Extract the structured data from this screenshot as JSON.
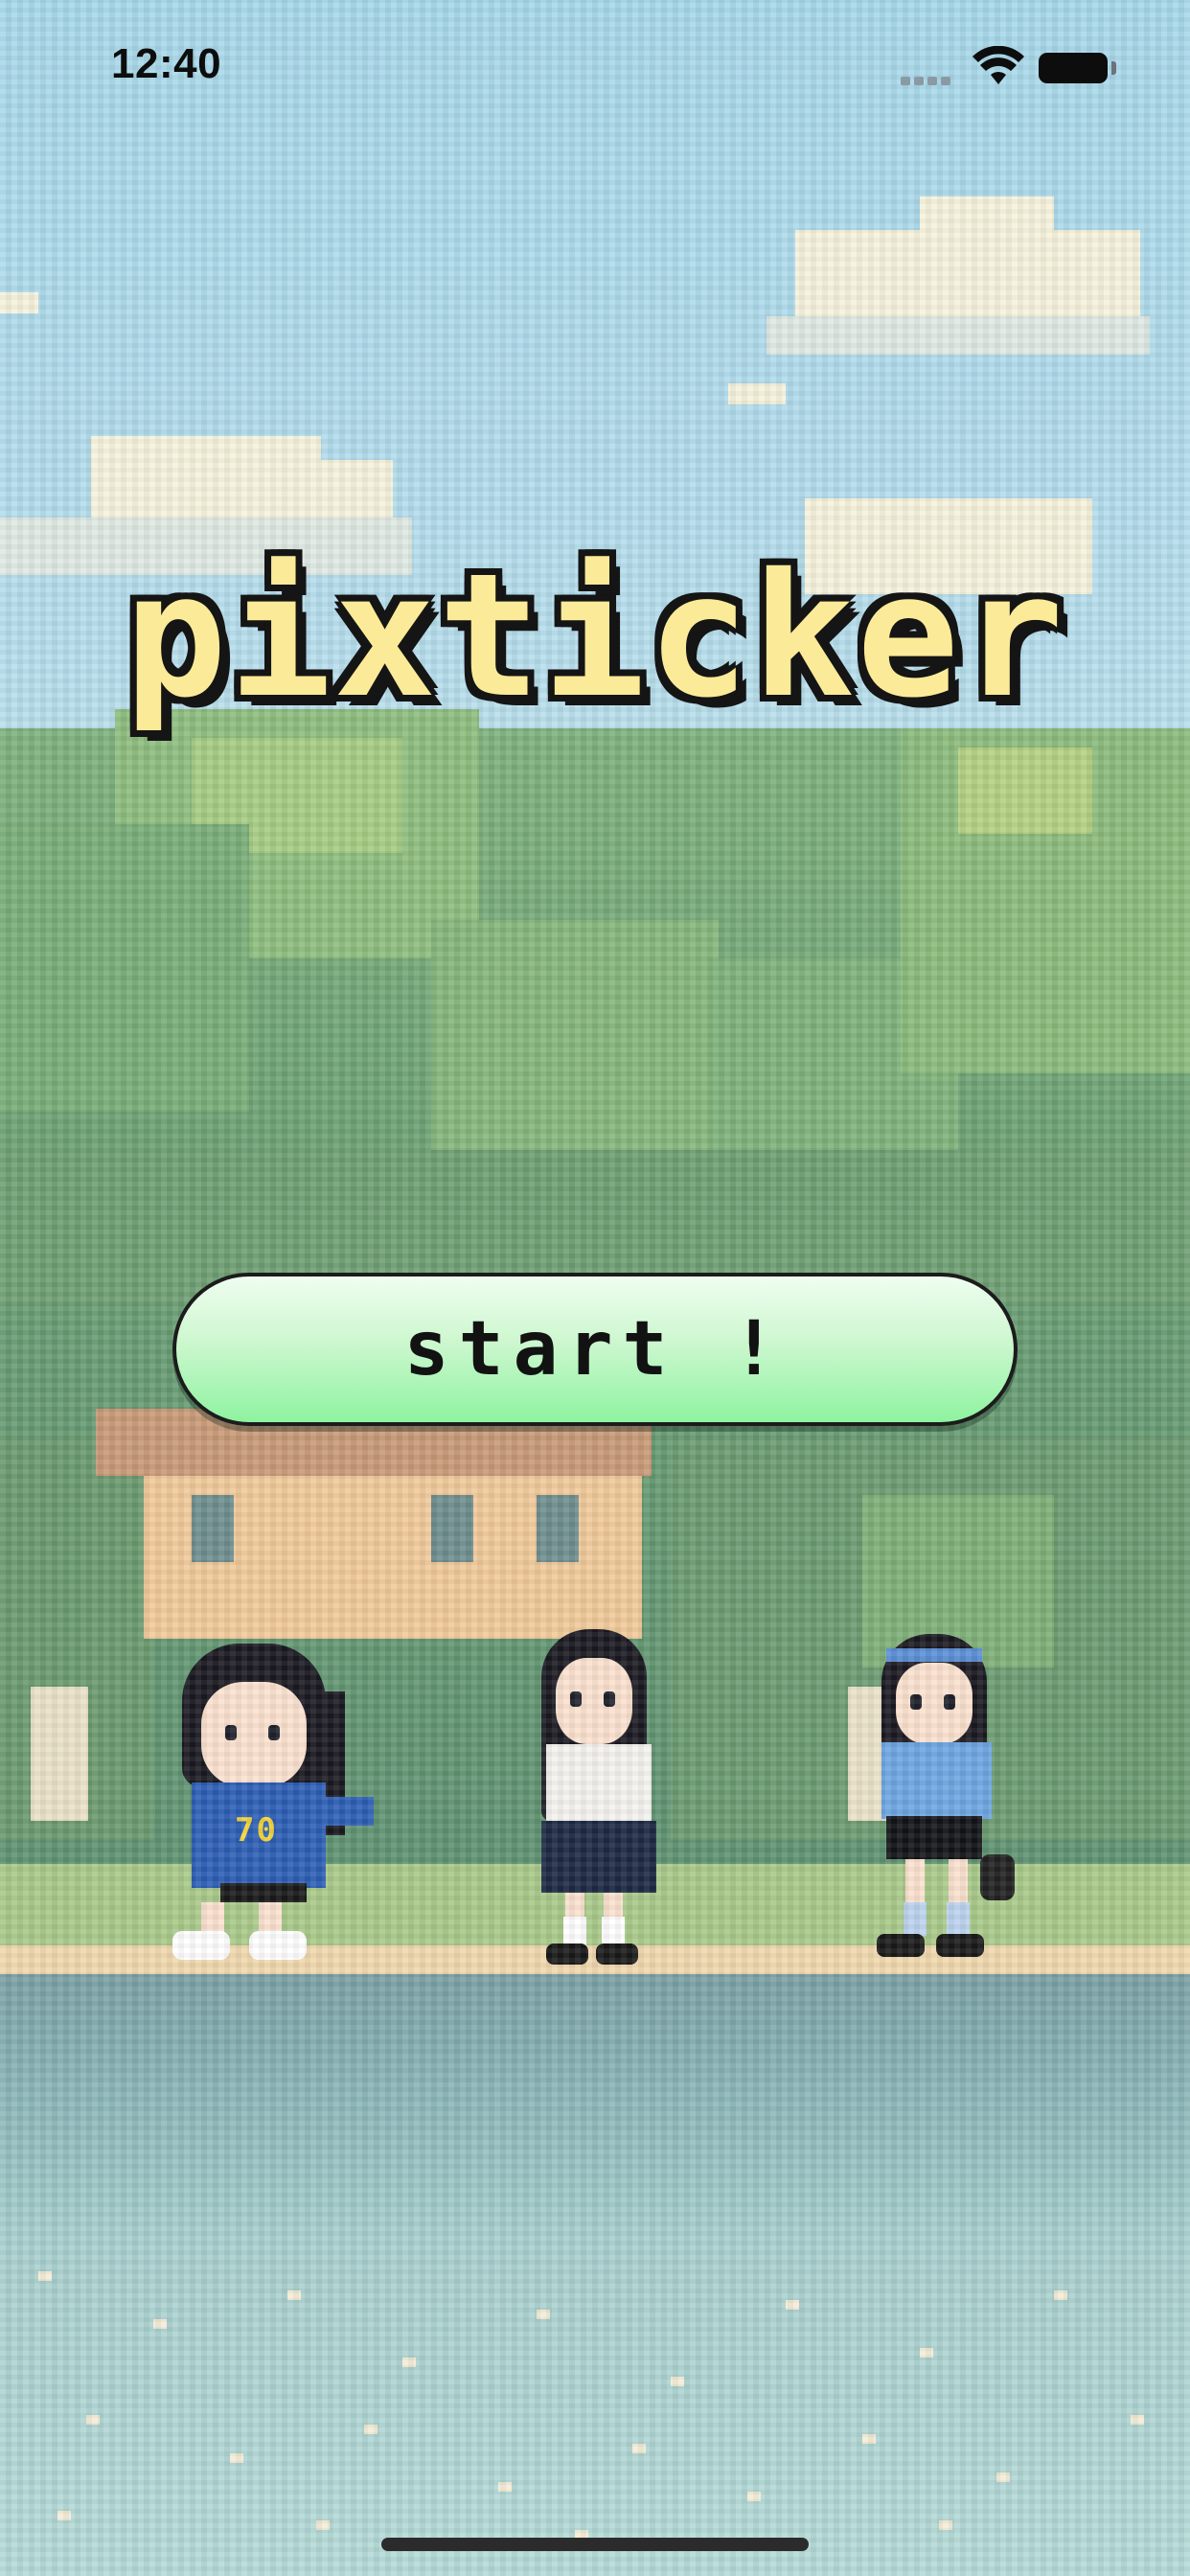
{
  "status_bar": {
    "time": "12:40",
    "icons": [
      "signal-icon",
      "wifi-icon",
      "battery-icon"
    ]
  },
  "app": {
    "title": "pixticker",
    "start_label": "start !"
  },
  "characters": [
    {
      "name": "girl-in-blue-jersey",
      "jersey_text": "70"
    },
    {
      "name": "girl-in-school-uniform"
    },
    {
      "name": "girl-in-blue-blouse"
    }
  ],
  "colors": {
    "sky": "#a9d7e6",
    "title_fill": "#fbeb98",
    "title_outline": "#151515",
    "button_top": "#effdf0",
    "button_bottom": "#8ef3a0"
  }
}
